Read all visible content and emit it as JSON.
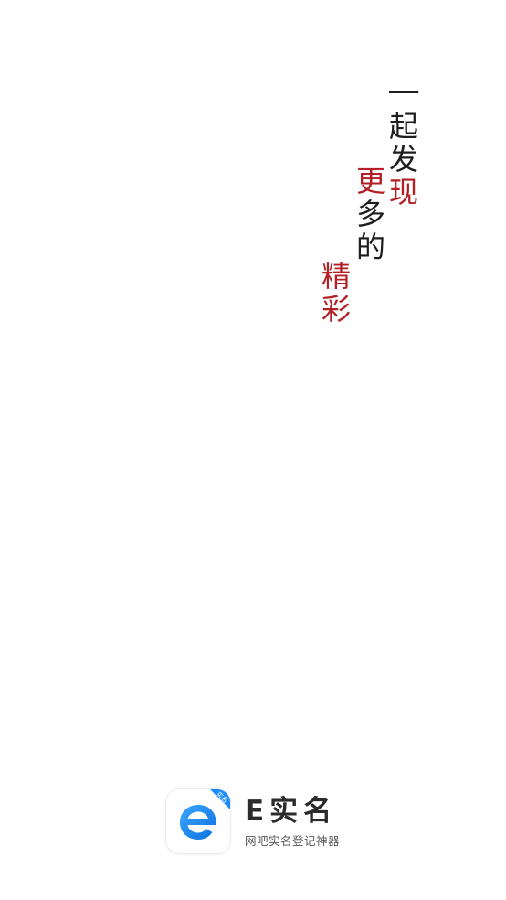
{
  "poem": {
    "column1": [
      {
        "char": "一",
        "accent": false
      },
      {
        "char": "起",
        "accent": false
      },
      {
        "char": "发",
        "accent": false
      },
      {
        "char": "现",
        "accent": true
      }
    ],
    "column2": [
      {
        "char": "更",
        "accent": true
      },
      {
        "char": "多",
        "accent": false
      },
      {
        "char": "的",
        "accent": false
      }
    ],
    "column3": [
      {
        "char": "精",
        "accent": true
      },
      {
        "char": "彩",
        "accent": true
      }
    ]
  },
  "colors": {
    "text": "#1e1e1e",
    "accent": "#b21f24",
    "brand_blue": "#1a8cff",
    "background": "#ffffff"
  },
  "brand": {
    "icon": "e-logo-icon",
    "badge_text": "实名",
    "name": "E实名",
    "slogan": "网吧实名登记神器"
  }
}
